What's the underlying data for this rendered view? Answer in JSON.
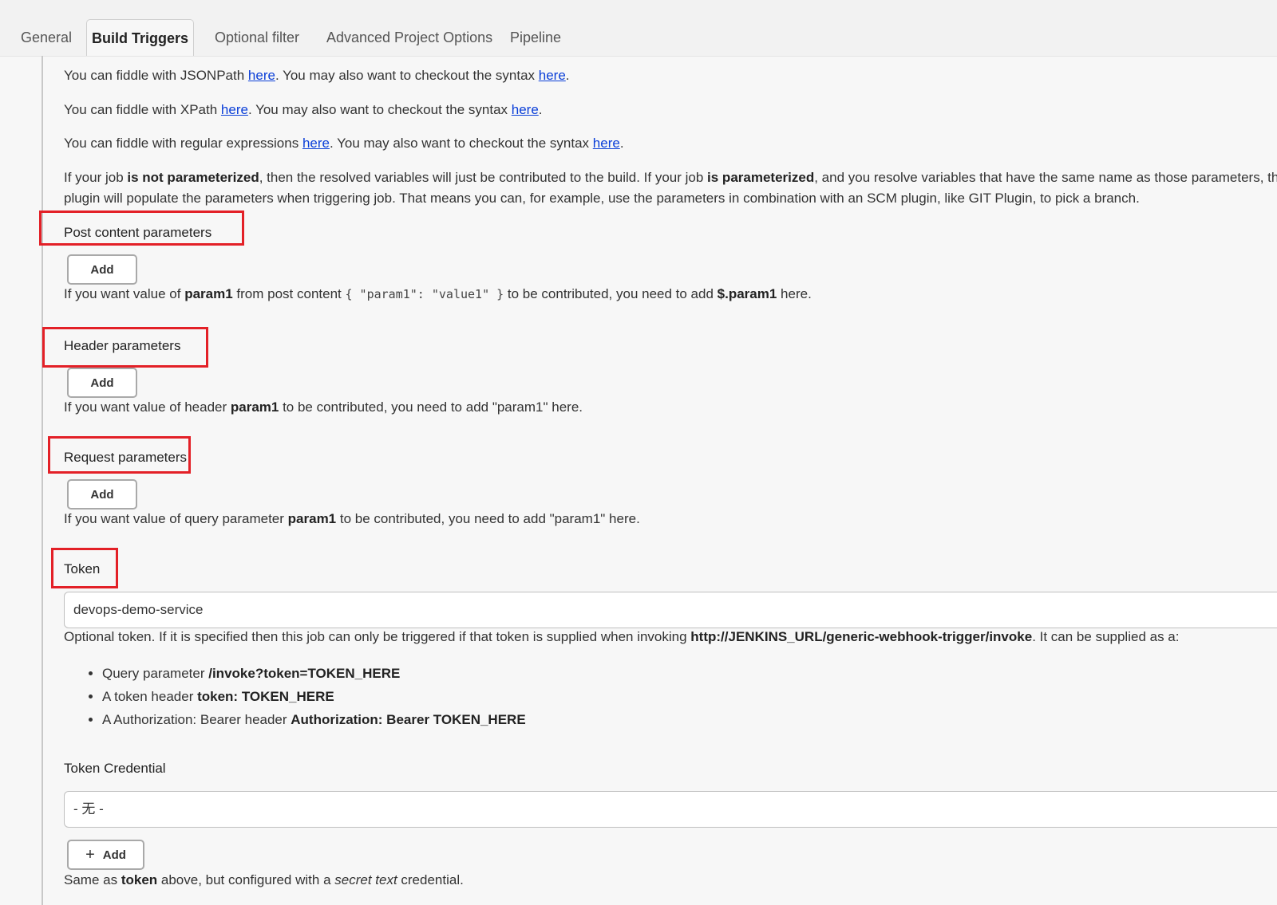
{
  "tabs": [
    {
      "label": "General"
    },
    {
      "label": "Build Triggers"
    },
    {
      "label": "Optional filter"
    },
    {
      "label": "Advanced Project Options"
    },
    {
      "label": "Pipeline"
    }
  ],
  "help": {
    "jsonpath": {
      "pre": "You can fiddle with JSONPath ",
      "link1": "here",
      "mid": ". You may also want to checkout the syntax ",
      "link2": "here",
      "post": "."
    },
    "xpath": {
      "pre": "You can fiddle with XPath ",
      "link1": "here",
      "mid": ". You may also want to checkout the syntax ",
      "link2": "here",
      "post": "."
    },
    "regex": {
      "pre": "You can fiddle with regular expressions ",
      "link1": "here",
      "mid": ". You may also want to checkout the syntax ",
      "link2": "here",
      "post": "."
    },
    "param_line1": {
      "t1": "If your job ",
      "b1": "is not parameterized",
      "t2": ", then the resolved variables will just be contributed to the build. If your job ",
      "b2": "is parameterized",
      "t3": ", and you resolve variables that have the same name as those parameters, the"
    },
    "param_line2": "plugin will populate the parameters when triggering job. That means you can, for example, use the parameters in combination with an SCM plugin, like GIT Plugin, to pick a branch."
  },
  "post_content": {
    "title": "Post content parameters",
    "add_label": "Add",
    "help": {
      "t1": "If you want value of ",
      "b1": "param1",
      "t2": " from post content ",
      "code": "{ \"param1\": \"value1\" }",
      "t3": " to be contributed, you need to add ",
      "b2": "$.param1",
      "t4": " here."
    }
  },
  "header_params": {
    "title": "Header parameters",
    "add_label": "Add",
    "help": {
      "t1": "If you want value of header ",
      "b1": "param1",
      "t2": " to be contributed, you need to add \"param1\" here."
    }
  },
  "request_params": {
    "title": "Request parameters",
    "add_label": "Add",
    "help": {
      "t1": "If you want value of query parameter ",
      "b1": "param1",
      "t2": " to be contributed, you need to add \"param1\" here."
    }
  },
  "token": {
    "title": "Token",
    "value": "devops-demo-service",
    "help": {
      "t1": "Optional token. If it is specified then this job can only be triggered if that token is supplied when invoking ",
      "b1": "http://JENKINS_URL/generic-webhook-trigger/invoke",
      "t2": ". It can be supplied as a:"
    },
    "bullets": [
      {
        "text": "Query parameter ",
        "bold": "/invoke?token=TOKEN_HERE"
      },
      {
        "text": "A token header ",
        "bold": "token: TOKEN_HERE"
      },
      {
        "text": "A Authorization: Bearer header ",
        "bold": "Authorization: Bearer TOKEN_HERE"
      }
    ]
  },
  "token_credential": {
    "title": "Token Credential",
    "selected": "- 无 -",
    "add_label": "Add",
    "help": {
      "t1": "Same as ",
      "b1": "token",
      "t2": " above, but configured with a ",
      "i1": "secret text",
      "t3": " credential."
    }
  }
}
